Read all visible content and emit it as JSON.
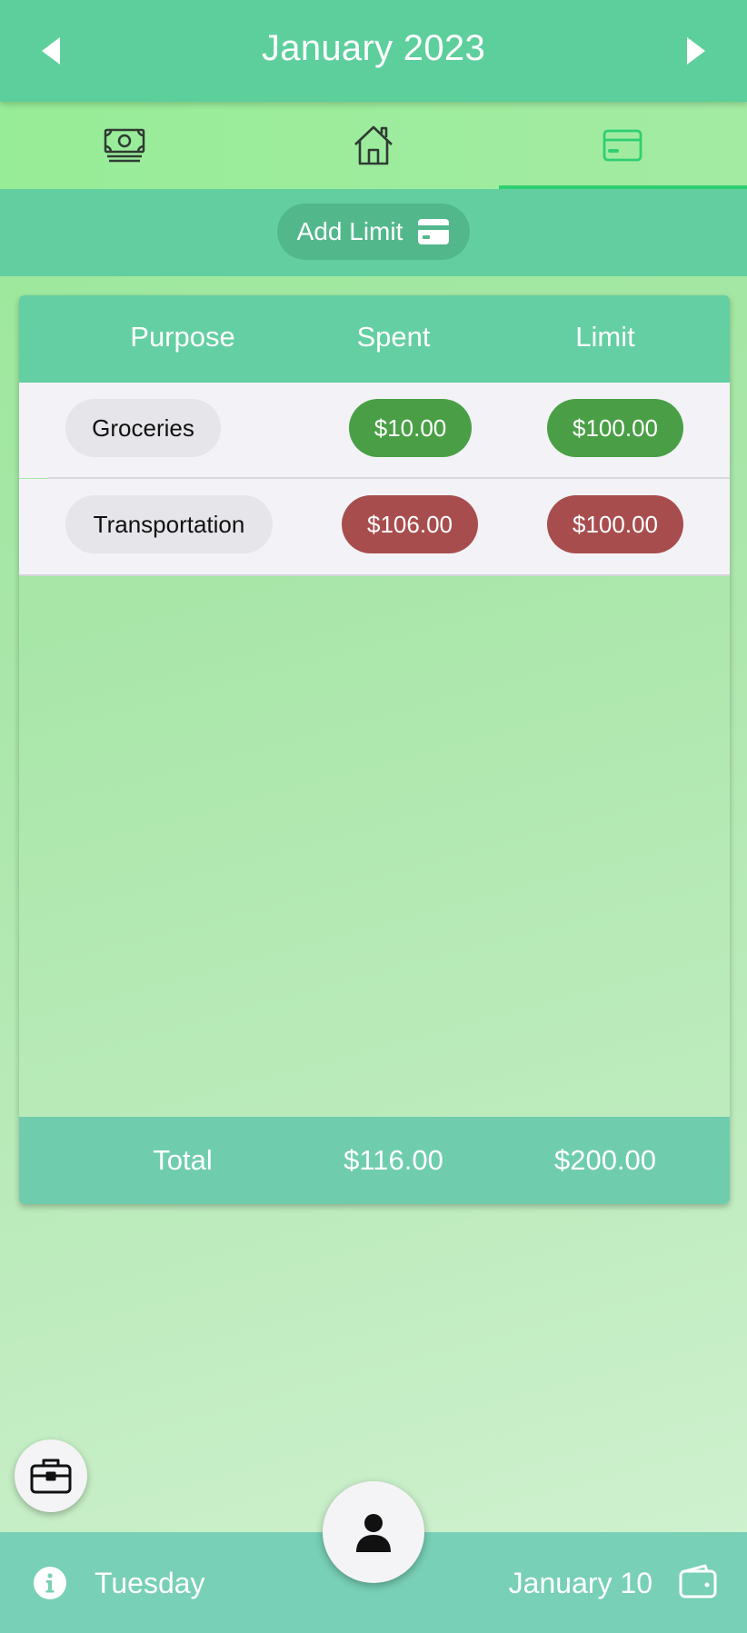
{
  "header": {
    "title": "January 2023",
    "prev_icon": "chevron-left-icon",
    "next_icon": "chevron-right-icon"
  },
  "tabs": [
    {
      "icon": "money-icon",
      "active": false
    },
    {
      "icon": "home-icon",
      "active": false
    },
    {
      "icon": "credit-card-icon",
      "active": true
    }
  ],
  "actions": {
    "add_limit_label": "Add Limit",
    "add_limit_icon": "credit-card-icon"
  },
  "table": {
    "columns": [
      "Purpose",
      "Spent",
      "Limit"
    ],
    "rows": [
      {
        "purpose": "Groceries",
        "spent": "$10.00",
        "limit": "$100.00",
        "status": "ok"
      },
      {
        "purpose": "Transportation",
        "spent": "$106.00",
        "limit": "$100.00",
        "status": "over"
      }
    ],
    "total": {
      "label": "Total",
      "spent": "$116.00",
      "limit": "$200.00"
    }
  },
  "footer": {
    "day": "Tuesday",
    "date": "January 10",
    "info_icon": "info-icon",
    "wallet_icon": "wallet-icon"
  },
  "fabs": {
    "left_icon": "briefcase-icon",
    "center_icon": "user-icon"
  },
  "colors": {
    "header": "#5dcf9d",
    "tab_active": "#2fcf71",
    "ok": "#4a9f46",
    "over": "#a84d4d",
    "bottom_bar": "#78d0b6"
  }
}
